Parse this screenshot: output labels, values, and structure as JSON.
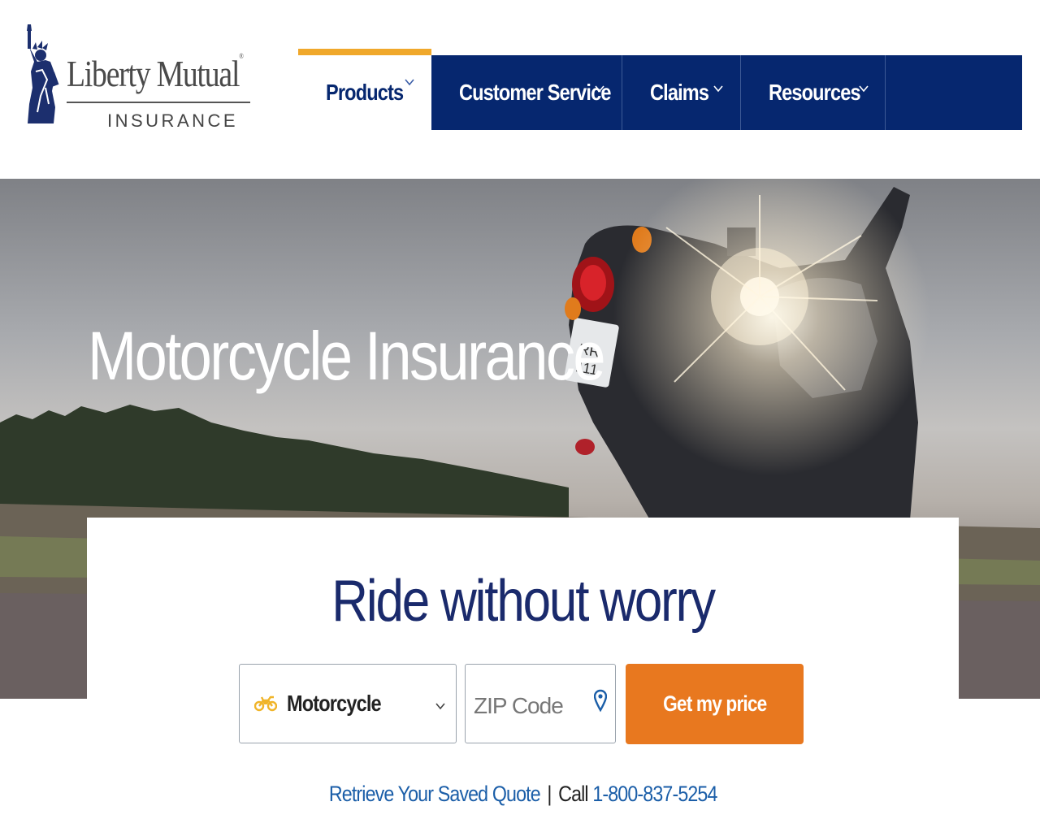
{
  "brand": {
    "name": "Liberty Mutual",
    "registered_mark": "®",
    "tagline": "INSURANCE"
  },
  "nav": {
    "items": [
      {
        "label": "Products",
        "active": true
      },
      {
        "label": "Customer Service",
        "active": false
      },
      {
        "label": "Claims",
        "active": false
      },
      {
        "label": "Resources",
        "active": false
      }
    ]
  },
  "hero": {
    "title": "Motorcycle Insurance",
    "image": "motorcycle-at-sunset"
  },
  "quote": {
    "headline": "Ride without worry",
    "product_select": {
      "value": "Motorcycle",
      "icon": "motorcycle-icon"
    },
    "zip": {
      "placeholder": "ZIP Code",
      "value": "",
      "icon": "location-pin-icon"
    },
    "cta_label": "Get my price",
    "retrieve_link": "Retrieve Your Saved Quote",
    "separator": "|",
    "call_prefix": "Call",
    "phone": "1-800-837-5254"
  },
  "colors": {
    "navy": "#06276f",
    "accent_gold": "#f0a82b",
    "cta_orange": "#e8781f",
    "link_blue": "#1b5ea8",
    "headline_navy": "#1a2a6c"
  }
}
